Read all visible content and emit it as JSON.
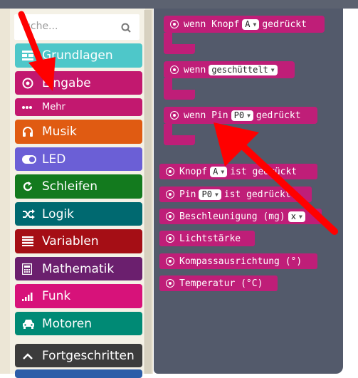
{
  "search": {
    "placeholder": "uche..."
  },
  "categories": [
    {
      "label": "Grundlagen",
      "icon": "grid-icon",
      "color": "#4ec7c9"
    },
    {
      "label": "Eingabe",
      "icon": "target-icon",
      "color": "#c2186f"
    },
    {
      "label": "Mehr",
      "icon": "dots-icon",
      "color": "#c2186f"
    },
    {
      "label": "Musik",
      "icon": "headphones-icon",
      "color": "#e05b12"
    },
    {
      "label": "LED",
      "icon": "toggle-icon",
      "color": "#6b5fd6"
    },
    {
      "label": "Schleifen",
      "icon": "loop-icon",
      "color": "#137a1e"
    },
    {
      "label": "Logik",
      "icon": "shuffle-icon",
      "color": "#006970"
    },
    {
      "label": "Variablen",
      "icon": "list-icon",
      "color": "#a50e15"
    },
    {
      "label": "Mathematik",
      "icon": "calculator-icon",
      "color": "#6b1f6e"
    },
    {
      "label": "Funk",
      "icon": "signal-icon",
      "color": "#d7127a"
    },
    {
      "label": "Motoren",
      "icon": "car-icon",
      "color": "#008a75"
    },
    {
      "label": "Fortgeschritten",
      "icon": "chevron-up-icon",
      "color": "#3c3c3c"
    }
  ],
  "blocks": {
    "b1": {
      "pre": "wenn Knopf",
      "dd": "A",
      "post": "gedrückt"
    },
    "b2": {
      "pre": "wenn",
      "dd": "geschüttelt",
      "post": ""
    },
    "b3": {
      "pre": "wenn Pin",
      "dd": "P0",
      "post": "gedrückt"
    },
    "b4": {
      "pre": "Knopf",
      "dd": "A",
      "post": "ist gedrückt"
    },
    "b5": {
      "pre": "Pin",
      "dd": "P0",
      "post": "ist gedrückt"
    },
    "b6": {
      "pre": "Beschleunigung (mg)",
      "dd": "x",
      "post": ""
    },
    "b7": {
      "pre": "Lichtstärke",
      "dd": "",
      "post": ""
    },
    "b8": {
      "pre": "Kompassausrichtung (°)",
      "dd": "",
      "post": ""
    },
    "b9": {
      "pre": "Temperatur (°C)",
      "dd": "",
      "post": ""
    }
  },
  "colors": {
    "input_block": "#bf1e78",
    "arrow": "#ff0000",
    "workspace": "#535a6b"
  }
}
